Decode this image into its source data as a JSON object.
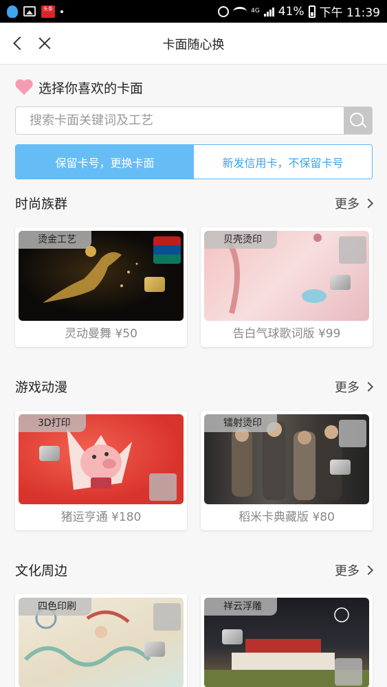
{
  "status_bar": {
    "news_icon_text": "头条",
    "signal_text": "4G",
    "battery_percent": "41%",
    "time": "下午 11:39"
  },
  "nav": {
    "title": "卡面随心换"
  },
  "header": {
    "subtitle": "选择你喜欢的卡面"
  },
  "search": {
    "placeholder": "搜索卡面关键词及工艺"
  },
  "segment": {
    "options": [
      "保留卡号，更换卡面",
      "新发信用卡，不保留卡号"
    ],
    "selected_index": 0
  },
  "sections": [
    {
      "title": "时尚族群",
      "more": "更多",
      "cards": [
        {
          "tag": "烫金工艺",
          "name": "灵动曼舞 ¥50"
        },
        {
          "tag": "贝壳烫印",
          "name": "告白气球歌词版 ¥99"
        }
      ]
    },
    {
      "title": "游戏动漫",
      "more": "更多",
      "cards": [
        {
          "tag": "3D打印",
          "name": "猪运亨通 ¥180"
        },
        {
          "tag": "镭射烫印",
          "name": "稻米卡典藏版 ¥80"
        }
      ]
    },
    {
      "title": "文化周边",
      "more": "更多",
      "cards": [
        {
          "tag": "四色印刷",
          "name": ""
        },
        {
          "tag": "祥云浮雕",
          "name": ""
        }
      ]
    }
  ],
  "colors": {
    "accent": "#66bdf6",
    "heart": "#f59bb2"
  }
}
